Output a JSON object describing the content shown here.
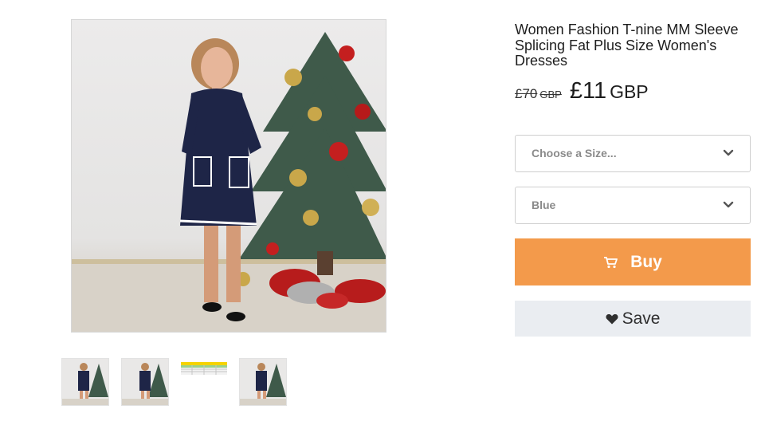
{
  "product": {
    "title": "Women Fashion T-nine MM Sleeve Splicing Fat Plus Size Women's Dresses",
    "old_price": "£70",
    "old_currency": "GBP",
    "new_price": "£11",
    "new_currency": "GBP"
  },
  "options": {
    "size_select": {
      "value": "Choose a Size...",
      "icon": "chevron-down-icon"
    },
    "color_select": {
      "value": "Blue",
      "icon": "chevron-down-icon"
    }
  },
  "actions": {
    "buy_label": "Buy",
    "buy_icon": "cart-icon",
    "save_label": "Save",
    "save_icon": "heart-icon"
  },
  "colors": {
    "buy_button": "#f39a4b",
    "save_button": "#eaedf1",
    "dress": "#1e2547",
    "tree": "#3f5a4a"
  },
  "gallery": {
    "thumbnails": [
      "dress-photo-1",
      "dress-photo-2",
      "size-chart",
      "dress-photo-3"
    ]
  }
}
